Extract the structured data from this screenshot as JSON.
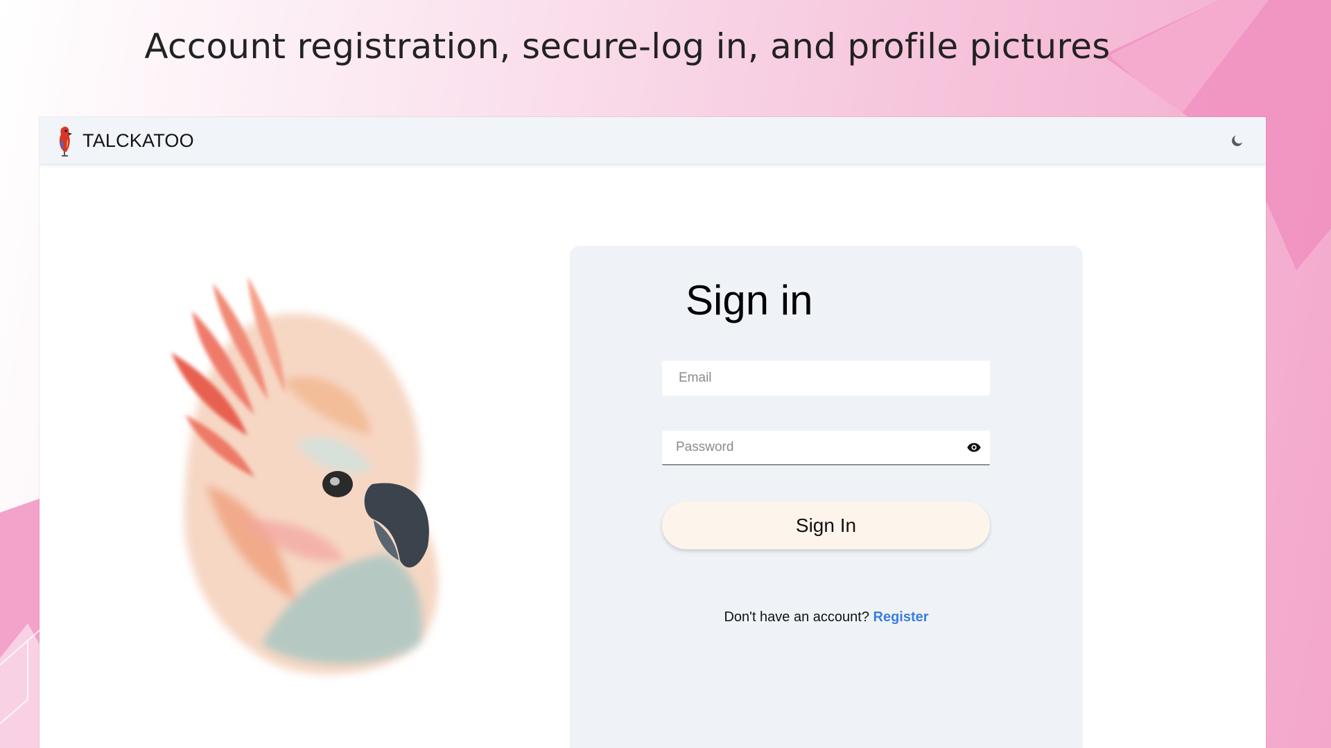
{
  "slide": {
    "title": "Account registration, secure-log in, and profile pictures"
  },
  "navbar": {
    "brand_name": "TALCKATOO",
    "brand_logo_icon": "parrot-logo-icon",
    "theme_toggle_icon": "moon-icon"
  },
  "hero": {
    "illustration": "cockatoo-watercolor-illustration"
  },
  "signin": {
    "heading": "Sign in",
    "email_placeholder": "Email",
    "password_placeholder": "Password",
    "password_toggle_icon": "eye-icon",
    "submit_label": "Sign In",
    "register_prompt": "Don't have an account?",
    "register_link": "Register"
  },
  "colors": {
    "card_background": "#eff3f8",
    "button_background": "#fdf4ec",
    "link": "#3a7de0",
    "navbar_background": "#f1f4f8",
    "slide_accent_pink": "#f08cbd"
  }
}
